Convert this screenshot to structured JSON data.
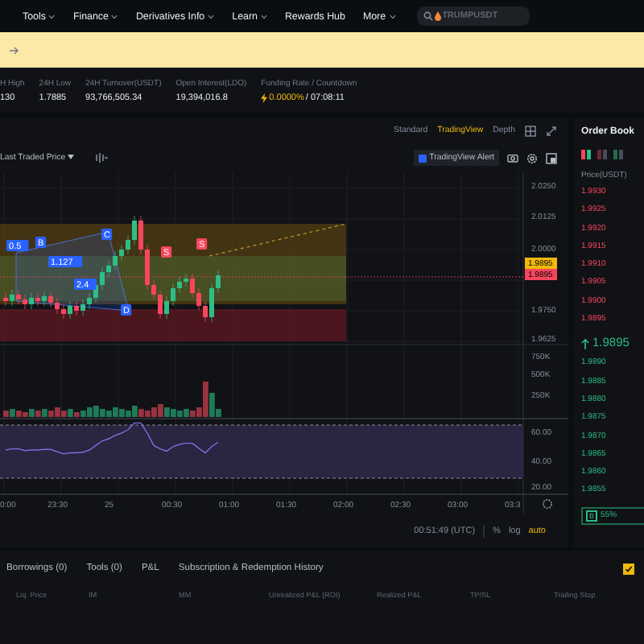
{
  "nav": {
    "items": [
      {
        "label": "Tools",
        "dropdown": true
      },
      {
        "label": "Finance",
        "dropdown": true
      },
      {
        "label": "Derivatives Info",
        "dropdown": true
      },
      {
        "label": "Learn",
        "dropdown": true
      },
      {
        "label": "Rewards Hub",
        "dropdown": false
      },
      {
        "label": "More",
        "dropdown": true
      }
    ],
    "search": {
      "placeholder": "TRUMPUSDT"
    }
  },
  "stats": [
    {
      "label": "H High",
      "value": "130"
    },
    {
      "label": "24H Low",
      "value": "1.7885"
    },
    {
      "label": "24H Turnover(USDT)",
      "value": "93,766,505.34"
    },
    {
      "label": "Open Interest(LDO)",
      "value": "19,394,016.8"
    },
    {
      "label": "Funding Rate / Countdown",
      "rate": "0.0000%",
      "countdown": "/ 07:08:11"
    }
  ],
  "chart_header": {
    "views": [
      {
        "label": "Standard",
        "selected": false
      },
      {
        "label": "TradingView",
        "selected": true
      },
      {
        "label": "Depth",
        "selected": false
      }
    ],
    "price_source": "Last Traded Price",
    "alert_button": "TradingView Alert"
  },
  "chart": {
    "price_axis": [
      "2.0250",
      "2.0125",
      "2.0000",
      "1.9750",
      "1.9625"
    ],
    "price_tags": [
      {
        "text": "1.9895",
        "color": "#f0b90b"
      },
      {
        "text": "1.9895",
        "color": "#f6465d"
      }
    ],
    "pattern_labels": [
      {
        "text": "0.5",
        "kind": "harmonic"
      },
      {
        "text": "B",
        "kind": "harmonic"
      },
      {
        "text": "1.127",
        "kind": "harmonic"
      },
      {
        "text": "C",
        "kind": "harmonic"
      },
      {
        "text": "2.4",
        "kind": "harmonic"
      },
      {
        "text": "D",
        "kind": "harmonic"
      },
      {
        "text": "S",
        "kind": "signal"
      },
      {
        "text": "S",
        "kind": "signal"
      }
    ],
    "volume_axis": [
      "750K",
      "500K",
      "250K"
    ],
    "rsi_axis": [
      "60.00",
      "40.00",
      "20.00"
    ],
    "time_axis": [
      "0:00",
      "23:30",
      "25",
      "00:30",
      "01:00",
      "01:30",
      "02:00",
      "02:30",
      "03:00",
      "03:3"
    ]
  },
  "chart_footer": {
    "time": "00:51:49 (UTC)",
    "options": [
      {
        "label": "%",
        "selected": false
      },
      {
        "label": "log",
        "selected": false
      },
      {
        "label": "auto",
        "selected": true
      }
    ]
  },
  "order_book": {
    "title": "Order Book",
    "column": "Price(USDT)",
    "asks": [
      "1.9930",
      "1.9925",
      "1.9920",
      "1.9915",
      "1.9910",
      "1.9905",
      "1.9900",
      "1.9895"
    ],
    "last_price": {
      "value": "1.9895",
      "up": true
    },
    "bids": [
      "1.9890",
      "1.9885",
      "1.9880",
      "1.9875",
      "1.9870",
      "1.9865",
      "1.9860",
      "1.9855"
    ],
    "ratio": {
      "side": "B",
      "value": "55%"
    }
  },
  "bottom": {
    "tabs": [
      {
        "label": "Borrowings (0)",
        "selected": false
      },
      {
        "label": "Tools (0)",
        "selected": false
      },
      {
        "label": "P&L",
        "selected": false
      },
      {
        "label": "Subscription & Redemption History",
        "selected": false
      }
    ],
    "checked": true,
    "columns": [
      "Liq. Price",
      "IM",
      "MM",
      "Unrealized P&L (ROI)",
      "Realized P&L",
      "TP/SL",
      "Trailing Stop"
    ]
  }
}
